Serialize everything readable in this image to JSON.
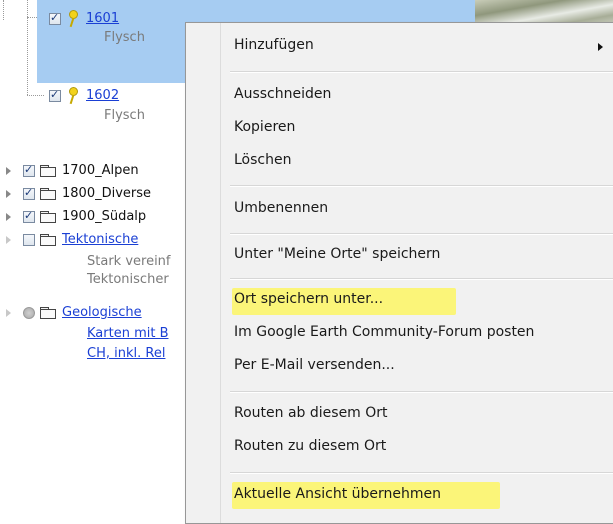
{
  "tree": {
    "items": [
      {
        "name": "1601",
        "subtitle": "Flysch"
      },
      {
        "name": "1602",
        "subtitle": "Flysch"
      },
      {
        "name": "1700_Alpen"
      },
      {
        "name": "1800_Diverse"
      },
      {
        "name": "1900_Südalp"
      },
      {
        "name": "Tektonische",
        "subtitle1": "Stark vereinf",
        "subtitle2": "Tektonischer"
      },
      {
        "name": "Geologische",
        "line2": "Karten mit B",
        "line3": "CH, inkl. Rel"
      }
    ]
  },
  "context_menu": {
    "items": [
      {
        "label": "Hinzufügen"
      },
      {
        "label": "Ausschneiden"
      },
      {
        "label": "Kopieren"
      },
      {
        "label": "Löschen"
      },
      {
        "label": "Umbenennen"
      },
      {
        "label": "Unter \"Meine Orte\" speichern"
      },
      {
        "label": "Ort speichern unter..."
      },
      {
        "label": "Im Google Earth Community-Forum posten"
      },
      {
        "label": "Per E-Mail versenden..."
      },
      {
        "label": "Routen ab diesem Ort"
      },
      {
        "label": "Routen zu diesem Ort"
      },
      {
        "label": "Aktuelle Ansicht übernehmen"
      }
    ]
  },
  "colors": {
    "selection": "#a6ccf2",
    "highlight": "#fbf579",
    "link": "#1a3fd4"
  }
}
